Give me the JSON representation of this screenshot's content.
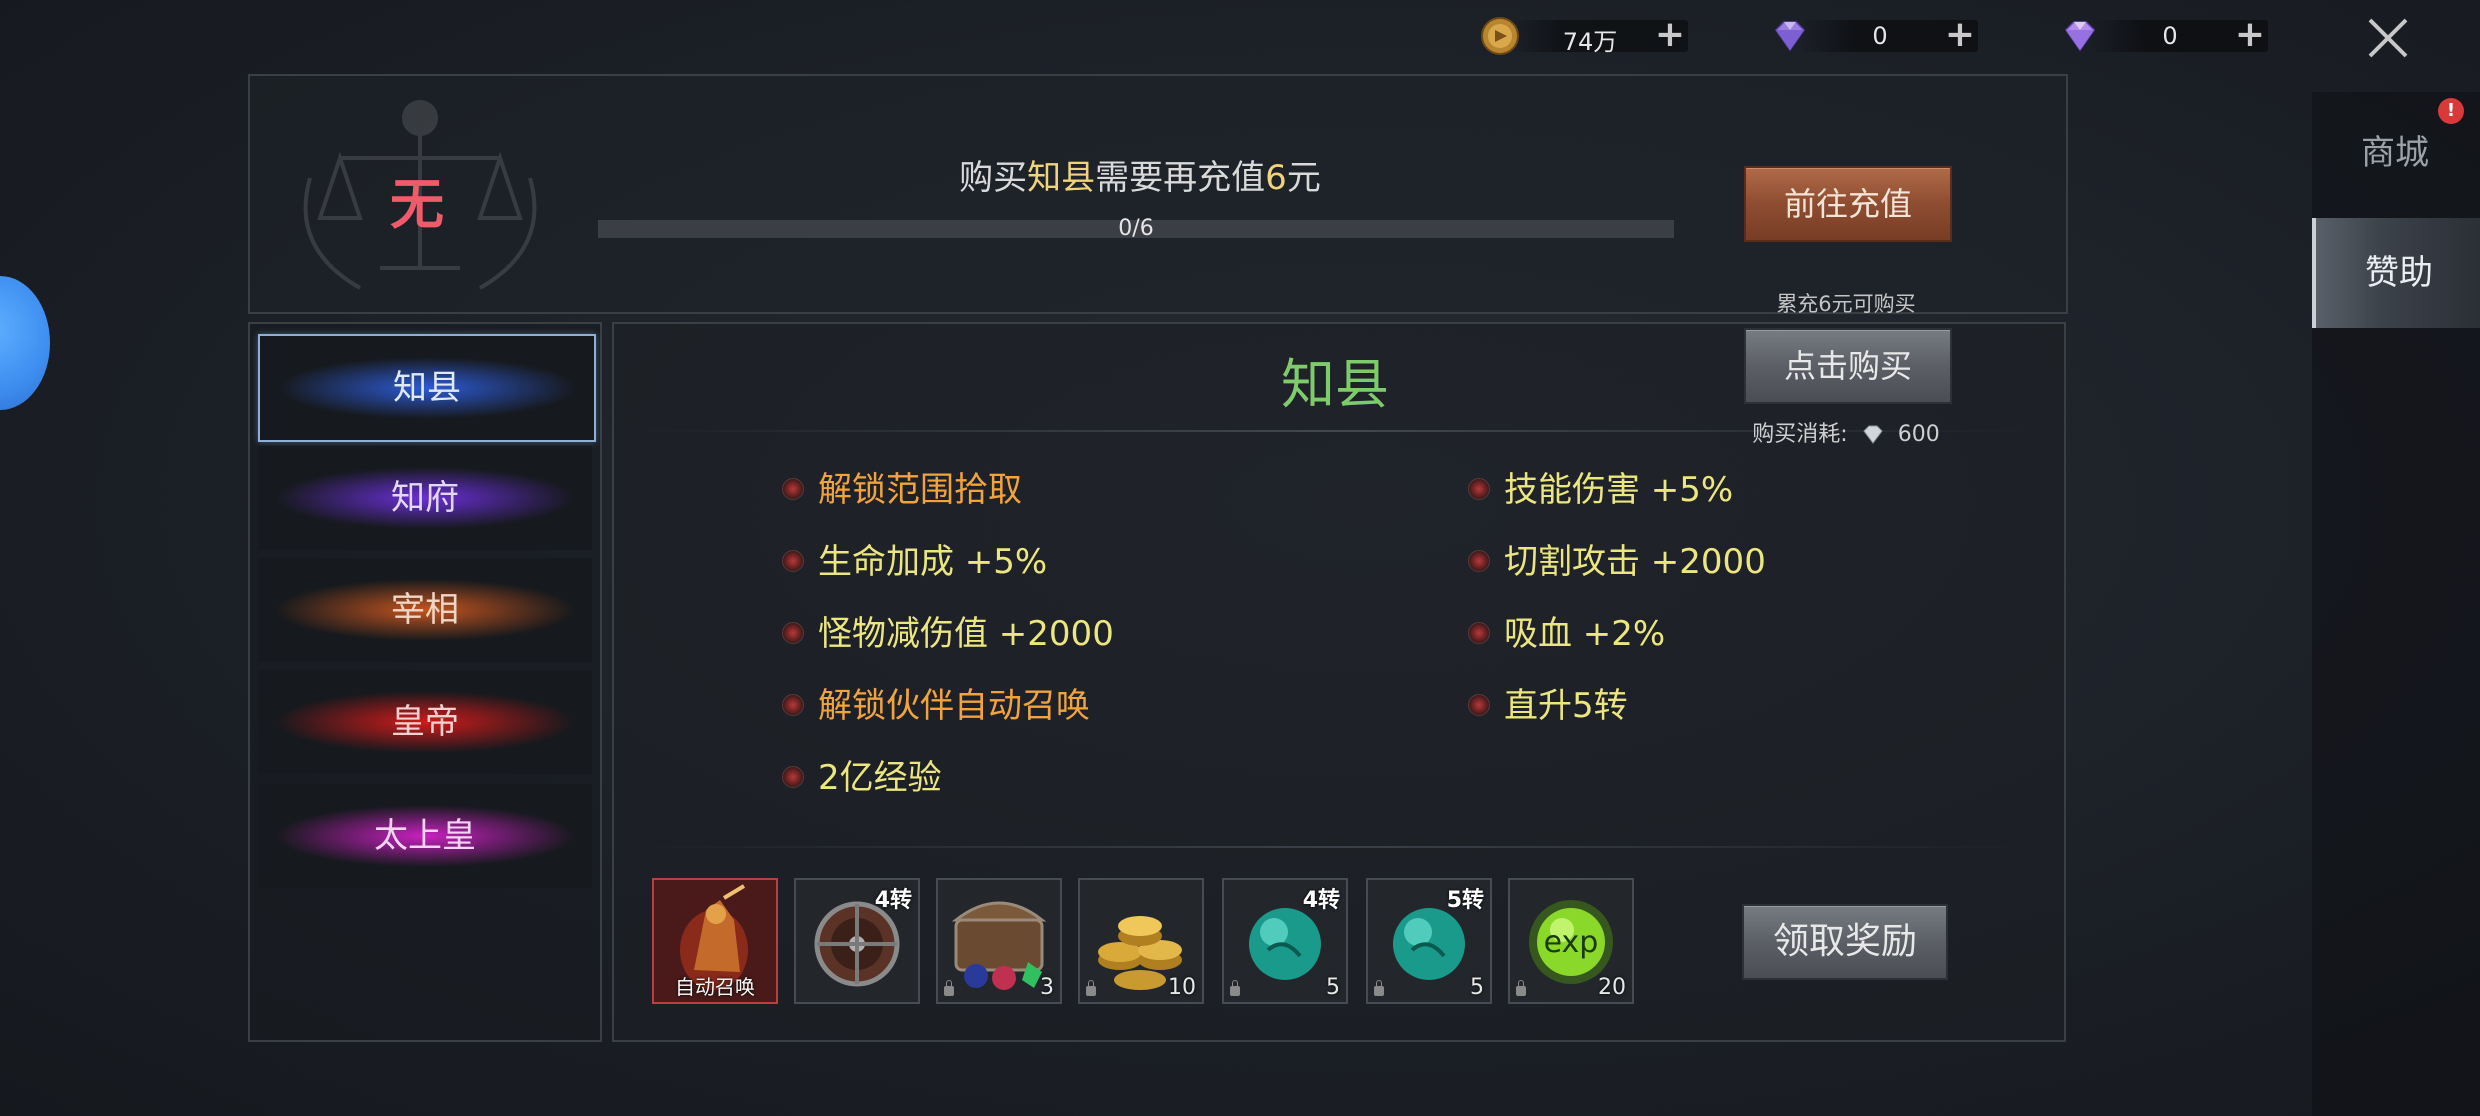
{
  "currency": [
    {
      "icon": "gold-coin-icon",
      "value": "74万"
    },
    {
      "icon": "bound-diamond-icon",
      "value": "0"
    },
    {
      "icon": "diamond-icon",
      "value": "0"
    }
  ],
  "side_tabs": [
    {
      "label": "商城",
      "active": false,
      "alert": "!"
    },
    {
      "label": "赞助",
      "active": true
    }
  ],
  "status": {
    "current_rank": "无",
    "requirement": {
      "prefix": "购买",
      "rank": "知县",
      "middle": "需要再充值",
      "amount": "6",
      "suffix": "元"
    },
    "progress_label": "0/6",
    "progress_fraction": 0,
    "recharge_button": "前往充值",
    "recharge_note": "累充6元可购买"
  },
  "ranks": [
    {
      "label": "知县",
      "selected": true,
      "glow": "#2d5bd6",
      "text_color": "#dfe8f6"
    },
    {
      "label": "知府",
      "selected": false,
      "glow": "#6a2fd8",
      "text_color": "#e2d8f8"
    },
    {
      "label": "宰相",
      "selected": false,
      "glow": "#c4541e",
      "text_color": "#f0d6c4"
    },
    {
      "label": "皇帝",
      "selected": false,
      "glow": "#d01a1a",
      "text_color": "#f4d0d0"
    },
    {
      "label": "太上皇",
      "selected": false,
      "glow": "#c820c0",
      "text_color": "#f4d4f2"
    }
  ],
  "detail": {
    "title": "知县",
    "buy_button": "点击购买",
    "cost_label": "购买消耗:",
    "cost_value": "600",
    "perks_left": [
      {
        "text": "解锁范围拾取",
        "color": "orange"
      },
      {
        "text": "生命加成 +5%",
        "color": "yellow"
      },
      {
        "text": "怪物减伤值 +2000",
        "color": "yellow"
      },
      {
        "text": "解锁伙伴自动召唤",
        "color": "orange"
      },
      {
        "text": "2亿经验",
        "color": "yellow"
      }
    ],
    "perks_right": [
      {
        "text": "技能伤害 +5%",
        "color": "yellow"
      },
      {
        "text": "切割攻击 +2000",
        "color": "yellow"
      },
      {
        "text": "吸血 +2%",
        "color": "yellow"
      },
      {
        "text": "直升5转",
        "color": "yellow"
      }
    ],
    "rewards": [
      {
        "name": "auto-summon-item",
        "caption": "自动召唤",
        "badge": "",
        "count": "",
        "locked": true
      },
      {
        "name": "shield-item",
        "caption": "",
        "badge": "4转",
        "count": "",
        "locked": false
      },
      {
        "name": "treasure-chest-item",
        "caption": "",
        "badge": "",
        "count": "3",
        "locked": true
      },
      {
        "name": "gold-coins-item",
        "caption": "",
        "badge": "",
        "count": "10",
        "locked": true
      },
      {
        "name": "jade-orb-item-4",
        "caption": "",
        "badge": "4转",
        "count": "5",
        "locked": true
      },
      {
        "name": "jade-orb-item-5",
        "caption": "",
        "badge": "5转",
        "count": "5",
        "locked": true
      },
      {
        "name": "exp-orb-item",
        "caption": "",
        "badge": "",
        "count": "20",
        "locked": true
      }
    ],
    "claim_button": "领取奖励"
  }
}
